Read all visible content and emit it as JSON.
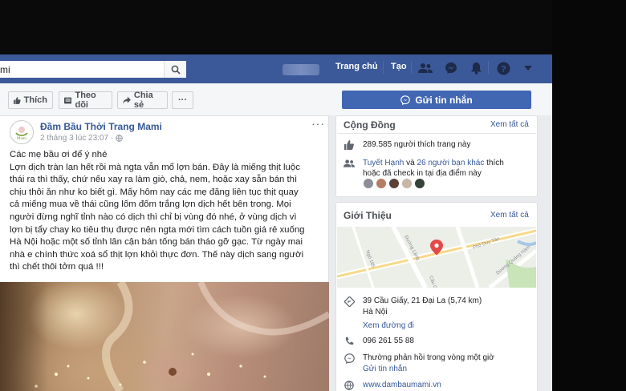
{
  "search": {
    "value": "mi"
  },
  "topnav": {
    "home": "Trang chủ",
    "create": "Tạo"
  },
  "actions": {
    "like": "Thích",
    "follow": "Theo dõi",
    "share": "Chia sẻ",
    "more": "···",
    "message": "Gửi tin nhắn"
  },
  "post": {
    "author": "Đầm Bầu Thời Trang Mami",
    "time": "2 tháng 3 lúc 23:07 ·",
    "more": "···",
    "lines": [
      "Các mẹ bầu ơi để ý nhé",
      "Lợn dịch tràn lan hết rồi mà ngta vẫn mổ lợn bán. Đây là miếng thịt luộc",
      "thái ra thì thấy, chứ nếu xay ra làm giò, chả, nem, hoặc xay sẵn bán thì",
      "chịu thôi ăn như ko biết gì. Mấy hôm nay các mẹ đăng liên tục thịt quay",
      "cả miếng mua về thái cũng lốm đốm trắng lợn dịch hết bên trong. Mọi",
      "người đừng nghĩ tỉnh nào có dịch thì chỉ bị vùng đó nhé, ở vùng dịch vì",
      "lợn bị tẩy chay ko tiêu thụ được nên ngta mới tìm cách tuồn giá rẻ xuống",
      "Hà Nội hoặc một số tỉnh lân cận bán tống bán tháo gỡ gạc. Từ ngày mai",
      "nhà e chính thức xoá sổ thịt lợn khỏi thực đơn. Thế này dịch sang người",
      "thì chết thôi tởm quá !!!"
    ]
  },
  "community": {
    "title": "Cộng Đồng",
    "see_all": "Xem tất cả",
    "likes": "289.585 người thích trang này",
    "friend1": "Tuyết Hạnh",
    "and": " và ",
    "friends_others": "26 người bạn khác",
    "friends_suffix_1": " thích",
    "friends_suffix_2": "hoặc đã check in tại địa điểm này"
  },
  "about": {
    "title": "Giới Thiệu",
    "see_all": "Xem tất cả",
    "address_1": "39 Cầu Giấy, 21 Đại La (5,74 km)",
    "address_2": "Hà Nội",
    "directions": "Xem đường đi",
    "phone": "096 261 55 88",
    "response": "Thường phản hồi trong vòng một giờ",
    "send_message": "Gửi tin nhắn",
    "website": "www.dambaumami.vn",
    "map_labels": [
      "Ngõ 165",
      "Đường Láng",
      "Phố Duy Tân",
      "Dương Quảng Hàm",
      "Cầu Giấy"
    ]
  },
  "icons": [
    "search-icon",
    "friends-icon",
    "messenger-icon",
    "bell-icon",
    "help-icon",
    "caret-icon",
    "like-icon",
    "follow-icon",
    "share-icon",
    "messenger-icon",
    "globe-icon",
    "thumb-icon",
    "people-icon",
    "pin-icon",
    "phone-icon",
    "messenger-outline-icon",
    "web-icon",
    "map-pin-icon"
  ],
  "colors": {
    "brand": "#3b5998",
    "button": "#4267b2",
    "link": "#365899"
  }
}
